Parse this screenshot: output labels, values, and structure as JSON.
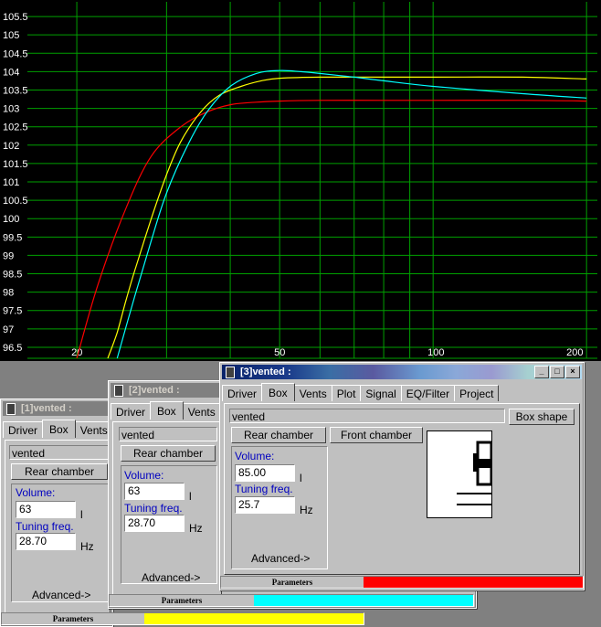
{
  "chart_data": {
    "type": "line",
    "x_scale": "log",
    "xlim": [
      16,
      210
    ],
    "ylim": [
      96.2,
      105.9
    ],
    "x_ticks": [
      20,
      50,
      100,
      200
    ],
    "x_tick_labels": [
      "20",
      "50",
      "100",
      "200"
    ],
    "x_minor_grid": [
      30,
      40,
      60,
      70,
      80,
      90
    ],
    "y_ticks": [
      96.5,
      97,
      97.5,
      98,
      98.5,
      99,
      99.5,
      100,
      100.5,
      101,
      101.5,
      102,
      102.5,
      103,
      103.5,
      104,
      104.5,
      105,
      105.5
    ],
    "y_tick_labels": [
      "96.5",
      "97",
      "97.5",
      "98",
      "98.5",
      "99",
      "99.5",
      "100",
      "100.5",
      "101",
      "101.5",
      "102",
      "102.5",
      "103",
      "103.5",
      "104",
      "104.5",
      "105",
      "105.5"
    ],
    "grid": true,
    "background": "#000000",
    "grid_color": "#00a000",
    "series": [
      {
        "color": "#ff0000",
        "x": [
          20,
          22,
          25,
          28,
          32,
          36,
          40,
          45,
          50,
          60,
          80,
          100,
          150,
          200
        ],
        "y": [
          96.2,
          98.2,
          100.3,
          101.7,
          102.5,
          102.9,
          103.1,
          103.17,
          103.2,
          103.22,
          103.22,
          103.22,
          103.22,
          103.2
        ]
      },
      {
        "color": "#ffff00",
        "x": [
          23,
          24,
          25,
          26,
          28,
          30,
          32,
          35,
          38,
          42,
          46,
          50,
          60,
          80,
          100,
          150,
          200
        ],
        "y": [
          96.2,
          96.9,
          97.8,
          98.6,
          100.0,
          101.2,
          102.1,
          102.9,
          103.35,
          103.6,
          103.75,
          103.82,
          103.85,
          103.85,
          103.85,
          103.85,
          103.8
        ]
      },
      {
        "color": "#00ffff",
        "x": [
          24,
          26,
          28,
          30,
          33,
          36,
          40,
          45,
          50,
          55,
          60,
          70,
          80,
          100,
          150,
          200
        ],
        "y": [
          96.2,
          97.9,
          99.4,
          100.7,
          102.0,
          102.9,
          103.6,
          103.95,
          104.03,
          104.0,
          103.95,
          103.85,
          103.75,
          103.6,
          103.4,
          103.28
        ]
      }
    ]
  },
  "windows": [
    {
      "title": "[1]vented :",
      "tabs": [
        "Driver",
        "Box",
        "Vents"
      ],
      "name_value": "vented",
      "rear_chamber_label": "Rear chamber",
      "volume_label": "Volume:",
      "volume_value": "63",
      "volume_unit": "l",
      "tuning_label": "Tuning freq.",
      "tuning_value": "28.70",
      "tuning_unit": "Hz",
      "advanced_label": "Advanced->",
      "status_label": "Parameters",
      "status_color": "#ffff00"
    },
    {
      "title": "[2]vented :",
      "tabs": [
        "Driver",
        "Box",
        "Vents"
      ],
      "name_value": "vented",
      "rear_chamber_label": "Rear chamber",
      "volume_label": "Volume:",
      "volume_value": "63",
      "volume_unit": "l",
      "tuning_label": "Tuning freq.",
      "tuning_value": "28.70",
      "tuning_unit": "Hz",
      "advanced_label": "Advanced->",
      "status_label": "Parameters",
      "status_color": "#00ffff"
    },
    {
      "title": "[3]vented :",
      "tabs": [
        "Driver",
        "Box",
        "Vents",
        "Plot",
        "Signal",
        "EQ/Filter",
        "Project"
      ],
      "name_value": "vented",
      "box_shape_label": "Box shape",
      "rear_chamber_label": "Rear chamber",
      "front_chamber_label": "Front chamber",
      "volume_label": "Volume:",
      "volume_value": "85.00",
      "volume_unit": "l",
      "tuning_label": "Tuning freq.",
      "tuning_value": "25.7",
      "tuning_unit": "Hz",
      "advanced_label": "Advanced->",
      "status_label": "Parameters",
      "status_color": "#ff0000",
      "caption_buttons": [
        "_",
        "□",
        "×"
      ]
    }
  ]
}
